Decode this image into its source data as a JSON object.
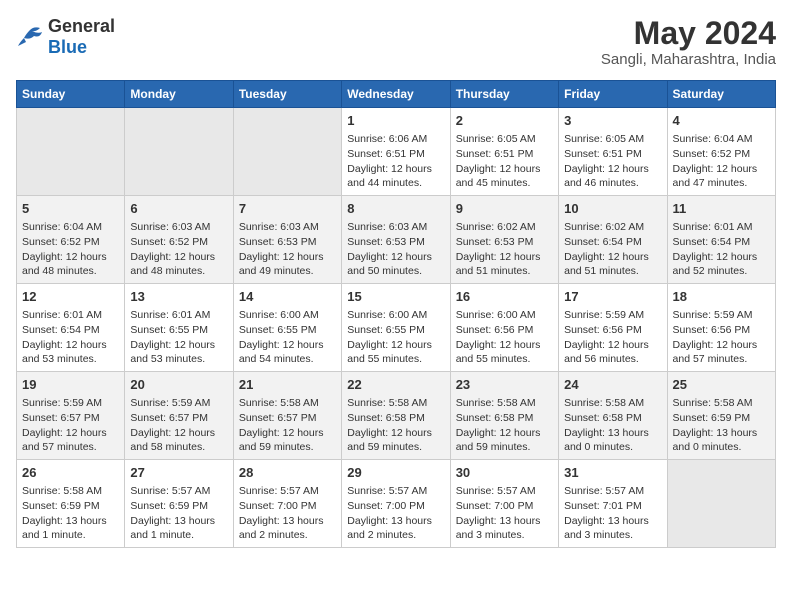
{
  "header": {
    "logo_general": "General",
    "logo_blue": "Blue",
    "title": "May 2024",
    "subtitle": "Sangli, Maharashtra, India"
  },
  "weekdays": [
    "Sunday",
    "Monday",
    "Tuesday",
    "Wednesday",
    "Thursday",
    "Friday",
    "Saturday"
  ],
  "weeks": [
    [
      {
        "num": "",
        "info": ""
      },
      {
        "num": "",
        "info": ""
      },
      {
        "num": "",
        "info": ""
      },
      {
        "num": "1",
        "info": "Sunrise: 6:06 AM\nSunset: 6:51 PM\nDaylight: 12 hours\nand 44 minutes."
      },
      {
        "num": "2",
        "info": "Sunrise: 6:05 AM\nSunset: 6:51 PM\nDaylight: 12 hours\nand 45 minutes."
      },
      {
        "num": "3",
        "info": "Sunrise: 6:05 AM\nSunset: 6:51 PM\nDaylight: 12 hours\nand 46 minutes."
      },
      {
        "num": "4",
        "info": "Sunrise: 6:04 AM\nSunset: 6:52 PM\nDaylight: 12 hours\nand 47 minutes."
      }
    ],
    [
      {
        "num": "5",
        "info": "Sunrise: 6:04 AM\nSunset: 6:52 PM\nDaylight: 12 hours\nand 48 minutes."
      },
      {
        "num": "6",
        "info": "Sunrise: 6:03 AM\nSunset: 6:52 PM\nDaylight: 12 hours\nand 48 minutes."
      },
      {
        "num": "7",
        "info": "Sunrise: 6:03 AM\nSunset: 6:53 PM\nDaylight: 12 hours\nand 49 minutes."
      },
      {
        "num": "8",
        "info": "Sunrise: 6:03 AM\nSunset: 6:53 PM\nDaylight: 12 hours\nand 50 minutes."
      },
      {
        "num": "9",
        "info": "Sunrise: 6:02 AM\nSunset: 6:53 PM\nDaylight: 12 hours\nand 51 minutes."
      },
      {
        "num": "10",
        "info": "Sunrise: 6:02 AM\nSunset: 6:54 PM\nDaylight: 12 hours\nand 51 minutes."
      },
      {
        "num": "11",
        "info": "Sunrise: 6:01 AM\nSunset: 6:54 PM\nDaylight: 12 hours\nand 52 minutes."
      }
    ],
    [
      {
        "num": "12",
        "info": "Sunrise: 6:01 AM\nSunset: 6:54 PM\nDaylight: 12 hours\nand 53 minutes."
      },
      {
        "num": "13",
        "info": "Sunrise: 6:01 AM\nSunset: 6:55 PM\nDaylight: 12 hours\nand 53 minutes."
      },
      {
        "num": "14",
        "info": "Sunrise: 6:00 AM\nSunset: 6:55 PM\nDaylight: 12 hours\nand 54 minutes."
      },
      {
        "num": "15",
        "info": "Sunrise: 6:00 AM\nSunset: 6:55 PM\nDaylight: 12 hours\nand 55 minutes."
      },
      {
        "num": "16",
        "info": "Sunrise: 6:00 AM\nSunset: 6:56 PM\nDaylight: 12 hours\nand 55 minutes."
      },
      {
        "num": "17",
        "info": "Sunrise: 5:59 AM\nSunset: 6:56 PM\nDaylight: 12 hours\nand 56 minutes."
      },
      {
        "num": "18",
        "info": "Sunrise: 5:59 AM\nSunset: 6:56 PM\nDaylight: 12 hours\nand 57 minutes."
      }
    ],
    [
      {
        "num": "19",
        "info": "Sunrise: 5:59 AM\nSunset: 6:57 PM\nDaylight: 12 hours\nand 57 minutes."
      },
      {
        "num": "20",
        "info": "Sunrise: 5:59 AM\nSunset: 6:57 PM\nDaylight: 12 hours\nand 58 minutes."
      },
      {
        "num": "21",
        "info": "Sunrise: 5:58 AM\nSunset: 6:57 PM\nDaylight: 12 hours\nand 59 minutes."
      },
      {
        "num": "22",
        "info": "Sunrise: 5:58 AM\nSunset: 6:58 PM\nDaylight: 12 hours\nand 59 minutes."
      },
      {
        "num": "23",
        "info": "Sunrise: 5:58 AM\nSunset: 6:58 PM\nDaylight: 12 hours\nand 59 minutes."
      },
      {
        "num": "24",
        "info": "Sunrise: 5:58 AM\nSunset: 6:58 PM\nDaylight: 13 hours\nand 0 minutes."
      },
      {
        "num": "25",
        "info": "Sunrise: 5:58 AM\nSunset: 6:59 PM\nDaylight: 13 hours\nand 0 minutes."
      }
    ],
    [
      {
        "num": "26",
        "info": "Sunrise: 5:58 AM\nSunset: 6:59 PM\nDaylight: 13 hours\nand 1 minute."
      },
      {
        "num": "27",
        "info": "Sunrise: 5:57 AM\nSunset: 6:59 PM\nDaylight: 13 hours\nand 1 minute."
      },
      {
        "num": "28",
        "info": "Sunrise: 5:57 AM\nSunset: 7:00 PM\nDaylight: 13 hours\nand 2 minutes."
      },
      {
        "num": "29",
        "info": "Sunrise: 5:57 AM\nSunset: 7:00 PM\nDaylight: 13 hours\nand 2 minutes."
      },
      {
        "num": "30",
        "info": "Sunrise: 5:57 AM\nSunset: 7:00 PM\nDaylight: 13 hours\nand 3 minutes."
      },
      {
        "num": "31",
        "info": "Sunrise: 5:57 AM\nSunset: 7:01 PM\nDaylight: 13 hours\nand 3 minutes."
      },
      {
        "num": "",
        "info": ""
      }
    ]
  ]
}
